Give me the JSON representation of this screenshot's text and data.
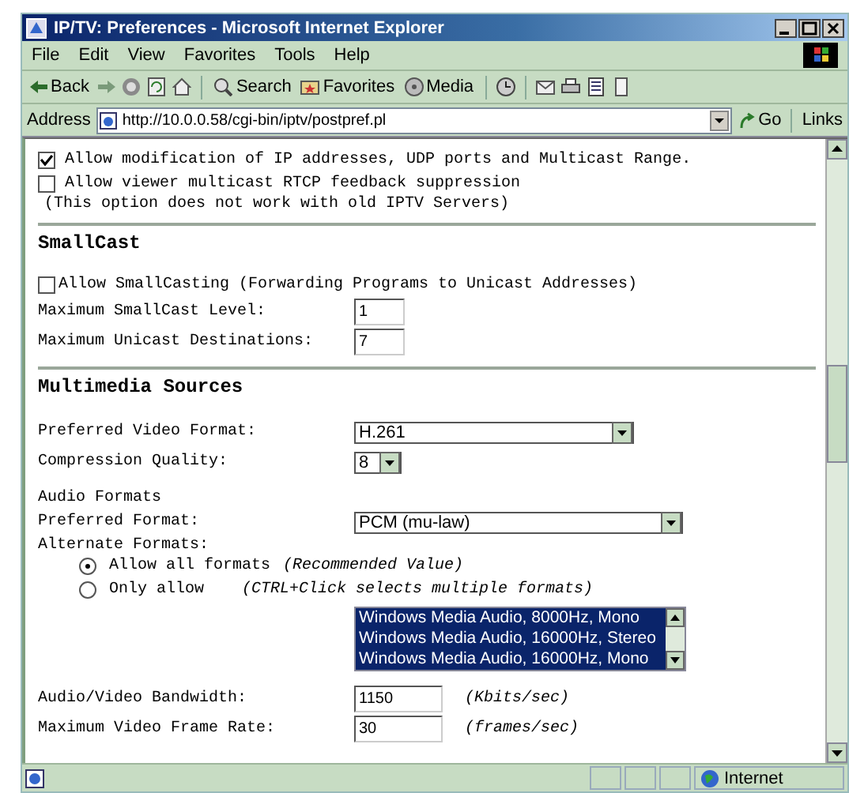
{
  "window": {
    "title": "IP/TV: Preferences - Microsoft Internet Explorer"
  },
  "menu": [
    "File",
    "Edit",
    "View",
    "Favorites",
    "Tools",
    "Help"
  ],
  "toolbar": [
    {
      "kind": "back",
      "label": "Back"
    },
    {
      "kind": "forward"
    },
    {
      "kind": "stop"
    },
    {
      "kind": "refresh"
    },
    {
      "kind": "home"
    },
    {
      "kind": "search",
      "label": "Search"
    },
    {
      "kind": "favorites",
      "label": "Favorites"
    },
    {
      "kind": "media",
      "label": "Media"
    },
    {
      "kind": "history"
    },
    {
      "kind": "mail"
    },
    {
      "kind": "print"
    },
    {
      "kind": "edit"
    },
    {
      "kind": "discuss"
    }
  ],
  "address": {
    "label": "Address",
    "value": "http://10.0.0.58/cgi-bin/iptv/postpref.pl",
    "go": "Go",
    "links": "Links"
  },
  "options": [
    {
      "label": "Allow modification of IP addresses, UDP ports and Multicast Range.",
      "checked": true
    },
    {
      "label": "Allow viewer multicast RTCP feedback suppression",
      "checked": false
    }
  ],
  "options_note": "(This option does not work with old IPTV Servers)",
  "smallcast": {
    "heading": "SmallCast",
    "checkbox": {
      "label": "Allow SmallCasting (Forwarding Programs to Unicast Addresses)",
      "checked": false
    },
    "fields": [
      {
        "label": "Maximum SmallCast Level:",
        "value": "1"
      },
      {
        "label": "Maximum Unicast Destinations:",
        "value": "7"
      }
    ]
  },
  "multimedia": {
    "heading": "Multimedia Sources",
    "video_format": {
      "label": "Preferred Video Format:",
      "value": "H.261"
    },
    "compression": {
      "label": "Compression Quality:",
      "value": "8"
    },
    "audio_heading": "Audio Formats",
    "preferred_format": {
      "label": "Preferred Format:",
      "value": "PCM (mu-law)"
    },
    "alternate_label": "Alternate Formats:",
    "radios": [
      {
        "label": "Allow all formats",
        "hint": "(Recommended Value)",
        "selected": true
      },
      {
        "label": "Only allow",
        "hint": "(CTRL+Click selects multiple formats)",
        "selected": false
      }
    ],
    "formats": [
      {
        "label": "Windows Media Audio, 8000Hz, Mono",
        "selected": true
      },
      {
        "label": "Windows Media Audio, 16000Hz, Stereo",
        "selected": true
      },
      {
        "label": "Windows Media Audio, 16000Hz, Mono",
        "selected": true
      }
    ],
    "bandwidth": {
      "label": "Audio/Video Bandwidth:",
      "value": "1150",
      "unit": "(Kbits/sec)"
    },
    "frame_rate": {
      "label": "Maximum Video Frame Rate:",
      "value": "30",
      "unit": "(frames/sec)"
    }
  },
  "status_bar": {
    "zone": "Internet"
  }
}
